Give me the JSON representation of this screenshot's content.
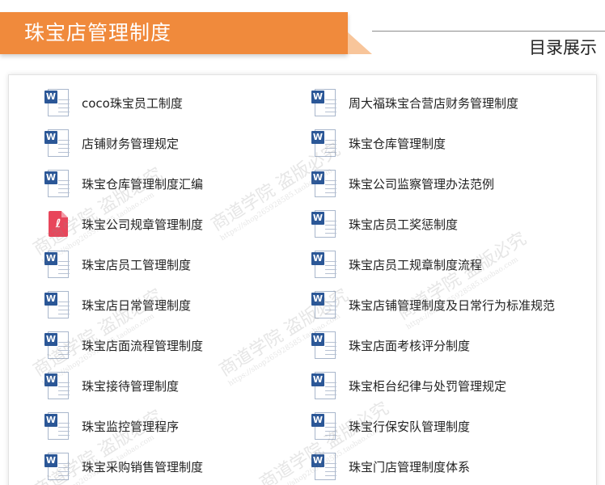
{
  "header": {
    "title": "珠宝店管理制度",
    "subtitle": "目录展示"
  },
  "colors": {
    "banner": "#f08a3c",
    "word_icon": "#2b5797",
    "pdf_icon": "#e8465b"
  },
  "watermark": {
    "text": "商道学院 盗版必究",
    "url": "https://shop265928585.taobao.com"
  },
  "files": {
    "left": [
      {
        "name": "coco珠宝员工制度",
        "icon": "word-doc-icon"
      },
      {
        "name": "店铺财务管理规定",
        "icon": "word-doc-icon"
      },
      {
        "name": "珠宝仓库管理制度汇编",
        "icon": "word-doc-icon"
      },
      {
        "name": "珠宝公司规章管理制度",
        "icon": "pdf-icon"
      },
      {
        "name": "珠宝店员工管理制度",
        "icon": "word-doc-icon"
      },
      {
        "name": "珠宝店日常管理制度",
        "icon": "word-doc-icon"
      },
      {
        "name": "珠宝店面流程管理制度",
        "icon": "word-doc-icon"
      },
      {
        "name": "珠宝接待管理制度",
        "icon": "word-doc-icon"
      },
      {
        "name": "珠宝监控管理程序",
        "icon": "word-doc-icon"
      },
      {
        "name": "珠宝采购销售管理制度",
        "icon": "word-doc-icon"
      }
    ],
    "right": [
      {
        "name": "周大福珠宝合营店财务管理制度",
        "icon": "word-doc-icon"
      },
      {
        "name": "珠宝仓库管理制度",
        "icon": "word-doc-icon"
      },
      {
        "name": "珠宝公司监察管理办法范例",
        "icon": "word-doc-icon"
      },
      {
        "name": "珠宝店员工奖惩制度",
        "icon": "word-doc-icon"
      },
      {
        "name": "珠宝店员工规章制度流程",
        "icon": "word-doc-icon"
      },
      {
        "name": "珠宝店铺管理制度及日常行为标准规范",
        "icon": "word-doc-icon"
      },
      {
        "name": "珠宝店面考核评分制度",
        "icon": "word-doc-icon"
      },
      {
        "name": "珠宝柜台纪律与处罚管理规定",
        "icon": "word-doc-icon"
      },
      {
        "name": "珠宝行保安队管理制度",
        "icon": "word-doc-icon"
      },
      {
        "name": "珠宝门店管理制度体系",
        "icon": "word-doc-icon"
      }
    ]
  }
}
